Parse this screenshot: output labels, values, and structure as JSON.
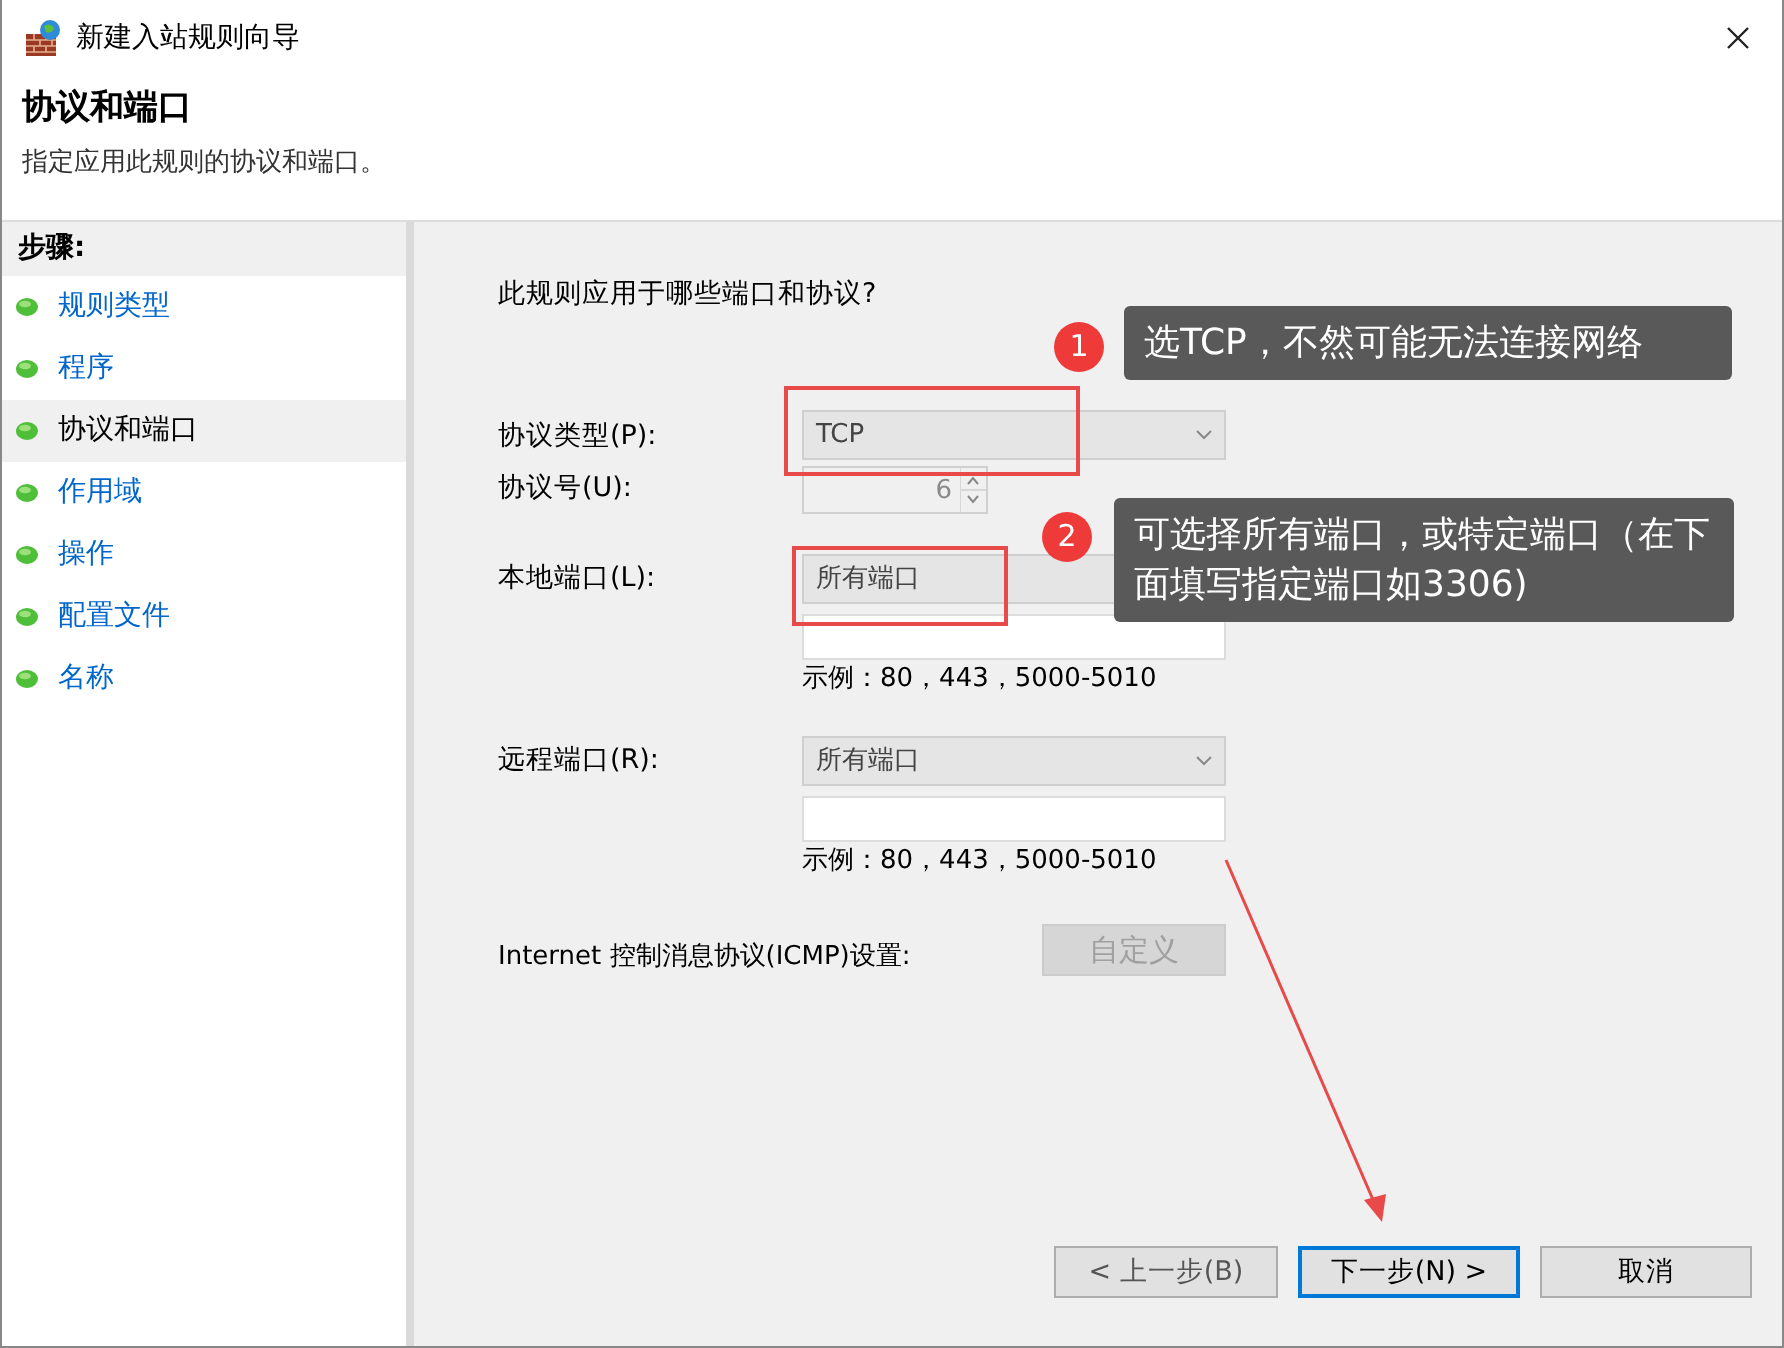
{
  "window": {
    "title": "新建入站规则向导"
  },
  "header": {
    "title": "协议和端口",
    "subtitle": "指定应用此规则的协议和端口。"
  },
  "steps": {
    "heading": "步骤:",
    "items": [
      {
        "label": "规则类型",
        "selected": false
      },
      {
        "label": "程序",
        "selected": false
      },
      {
        "label": "协议和端口",
        "selected": true
      },
      {
        "label": "作用域",
        "selected": false
      },
      {
        "label": "操作",
        "selected": false
      },
      {
        "label": "配置文件",
        "selected": false
      },
      {
        "label": "名称",
        "selected": false
      }
    ]
  },
  "question": "此规则应用于哪些端口和协议?",
  "fields": [
    {
      "kind": "combo",
      "label": "协议类型(P):",
      "value": "TCP"
    },
    {
      "kind": "spin",
      "label": "协议号(U):",
      "value": "6",
      "disabled": true
    },
    {
      "kind": "port",
      "label": "本地端口(L):",
      "value": "所有端口",
      "hint": "示例：80，443，5000-5010"
    },
    {
      "kind": "port",
      "label": "远程端口(R):",
      "value": "所有端口",
      "hint": "示例：80，443，5000-5010"
    }
  ],
  "icmp": {
    "label": "Internet 控制消息协议(ICMP)设置:",
    "button": "自定义",
    "disabled": true
  },
  "buttons": [
    {
      "label": "< 上一步(B)",
      "default": false
    },
    {
      "label": "下一步(N) >",
      "default": true
    },
    {
      "label": "取消",
      "default": false
    }
  ],
  "annotations": [
    {
      "number": "1",
      "text": "选TCP，不然可能无法连接网络"
    },
    {
      "number": "2",
      "text": "可选择所有端口，或特定端口（在下面填写指定端口如3306)"
    }
  ]
}
